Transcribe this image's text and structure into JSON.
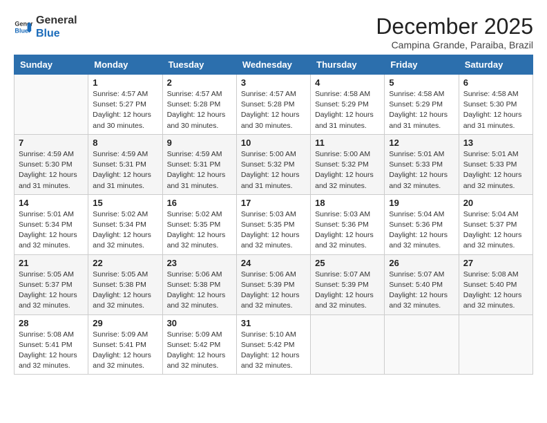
{
  "header": {
    "logo_line1": "General",
    "logo_line2": "Blue",
    "month_title": "December 2025",
    "location": "Campina Grande, Paraiba, Brazil"
  },
  "weekdays": [
    "Sunday",
    "Monday",
    "Tuesday",
    "Wednesday",
    "Thursday",
    "Friday",
    "Saturday"
  ],
  "weeks": [
    [
      {
        "day": "",
        "info": ""
      },
      {
        "day": "1",
        "info": "Sunrise: 4:57 AM\nSunset: 5:27 PM\nDaylight: 12 hours\nand 30 minutes."
      },
      {
        "day": "2",
        "info": "Sunrise: 4:57 AM\nSunset: 5:28 PM\nDaylight: 12 hours\nand 30 minutes."
      },
      {
        "day": "3",
        "info": "Sunrise: 4:57 AM\nSunset: 5:28 PM\nDaylight: 12 hours\nand 30 minutes."
      },
      {
        "day": "4",
        "info": "Sunrise: 4:58 AM\nSunset: 5:29 PM\nDaylight: 12 hours\nand 31 minutes."
      },
      {
        "day": "5",
        "info": "Sunrise: 4:58 AM\nSunset: 5:29 PM\nDaylight: 12 hours\nand 31 minutes."
      },
      {
        "day": "6",
        "info": "Sunrise: 4:58 AM\nSunset: 5:30 PM\nDaylight: 12 hours\nand 31 minutes."
      }
    ],
    [
      {
        "day": "7",
        "info": "Sunrise: 4:59 AM\nSunset: 5:30 PM\nDaylight: 12 hours\nand 31 minutes."
      },
      {
        "day": "8",
        "info": "Sunrise: 4:59 AM\nSunset: 5:31 PM\nDaylight: 12 hours\nand 31 minutes."
      },
      {
        "day": "9",
        "info": "Sunrise: 4:59 AM\nSunset: 5:31 PM\nDaylight: 12 hours\nand 31 minutes."
      },
      {
        "day": "10",
        "info": "Sunrise: 5:00 AM\nSunset: 5:32 PM\nDaylight: 12 hours\nand 31 minutes."
      },
      {
        "day": "11",
        "info": "Sunrise: 5:00 AM\nSunset: 5:32 PM\nDaylight: 12 hours\nand 32 minutes."
      },
      {
        "day": "12",
        "info": "Sunrise: 5:01 AM\nSunset: 5:33 PM\nDaylight: 12 hours\nand 32 minutes."
      },
      {
        "day": "13",
        "info": "Sunrise: 5:01 AM\nSunset: 5:33 PM\nDaylight: 12 hours\nand 32 minutes."
      }
    ],
    [
      {
        "day": "14",
        "info": "Sunrise: 5:01 AM\nSunset: 5:34 PM\nDaylight: 12 hours\nand 32 minutes."
      },
      {
        "day": "15",
        "info": "Sunrise: 5:02 AM\nSunset: 5:34 PM\nDaylight: 12 hours\nand 32 minutes."
      },
      {
        "day": "16",
        "info": "Sunrise: 5:02 AM\nSunset: 5:35 PM\nDaylight: 12 hours\nand 32 minutes."
      },
      {
        "day": "17",
        "info": "Sunrise: 5:03 AM\nSunset: 5:35 PM\nDaylight: 12 hours\nand 32 minutes."
      },
      {
        "day": "18",
        "info": "Sunrise: 5:03 AM\nSunset: 5:36 PM\nDaylight: 12 hours\nand 32 minutes."
      },
      {
        "day": "19",
        "info": "Sunrise: 5:04 AM\nSunset: 5:36 PM\nDaylight: 12 hours\nand 32 minutes."
      },
      {
        "day": "20",
        "info": "Sunrise: 5:04 AM\nSunset: 5:37 PM\nDaylight: 12 hours\nand 32 minutes."
      }
    ],
    [
      {
        "day": "21",
        "info": "Sunrise: 5:05 AM\nSunset: 5:37 PM\nDaylight: 12 hours\nand 32 minutes."
      },
      {
        "day": "22",
        "info": "Sunrise: 5:05 AM\nSunset: 5:38 PM\nDaylight: 12 hours\nand 32 minutes."
      },
      {
        "day": "23",
        "info": "Sunrise: 5:06 AM\nSunset: 5:38 PM\nDaylight: 12 hours\nand 32 minutes."
      },
      {
        "day": "24",
        "info": "Sunrise: 5:06 AM\nSunset: 5:39 PM\nDaylight: 12 hours\nand 32 minutes."
      },
      {
        "day": "25",
        "info": "Sunrise: 5:07 AM\nSunset: 5:39 PM\nDaylight: 12 hours\nand 32 minutes."
      },
      {
        "day": "26",
        "info": "Sunrise: 5:07 AM\nSunset: 5:40 PM\nDaylight: 12 hours\nand 32 minutes."
      },
      {
        "day": "27",
        "info": "Sunrise: 5:08 AM\nSunset: 5:40 PM\nDaylight: 12 hours\nand 32 minutes."
      }
    ],
    [
      {
        "day": "28",
        "info": "Sunrise: 5:08 AM\nSunset: 5:41 PM\nDaylight: 12 hours\nand 32 minutes."
      },
      {
        "day": "29",
        "info": "Sunrise: 5:09 AM\nSunset: 5:41 PM\nDaylight: 12 hours\nand 32 minutes."
      },
      {
        "day": "30",
        "info": "Sunrise: 5:09 AM\nSunset: 5:42 PM\nDaylight: 12 hours\nand 32 minutes."
      },
      {
        "day": "31",
        "info": "Sunrise: 5:10 AM\nSunset: 5:42 PM\nDaylight: 12 hours\nand 32 minutes."
      },
      {
        "day": "",
        "info": ""
      },
      {
        "day": "",
        "info": ""
      },
      {
        "day": "",
        "info": ""
      }
    ]
  ]
}
